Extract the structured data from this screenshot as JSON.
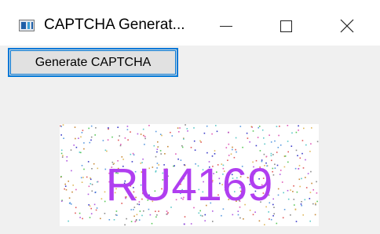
{
  "window": {
    "title": "CAPTCHA Generat...",
    "app_icon": "app-window-icon",
    "controls": {
      "minimize_icon": "minimize-icon",
      "maximize_icon": "maximize-icon",
      "close_icon": "close-icon"
    }
  },
  "toolbar": {
    "generate_label": "Generate CAPTCHA"
  },
  "captcha": {
    "text": "RU4169",
    "text_color": "#b03ef0",
    "noise_colors": [
      "#e05a5a",
      "#5a9ae0",
      "#5ac85a",
      "#b05ae0",
      "#e0b85a",
      "#5ac8c8",
      "#e05ab8",
      "#8a8a8a",
      "#c88a3a",
      "#3a3ac8"
    ]
  },
  "colors": {
    "accent": "#0078d7",
    "client_bg": "#f0f0f0"
  }
}
